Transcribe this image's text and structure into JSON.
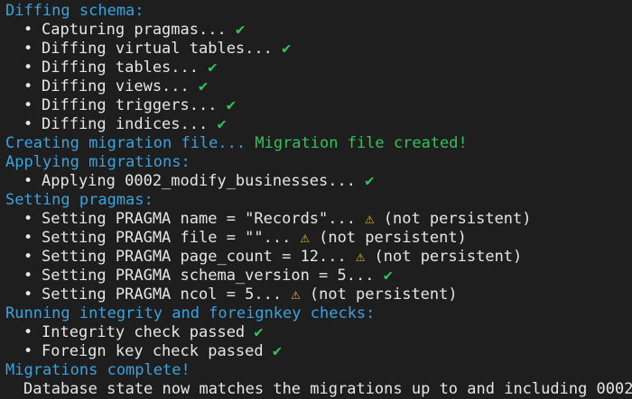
{
  "terminal": {
    "lines": [
      {
        "kind": "heading",
        "text": "Diffing schema:"
      },
      {
        "kind": "bullet",
        "text": "Capturing pragmas...",
        "status": "✔"
      },
      {
        "kind": "bullet",
        "text": "Diffing virtual tables...",
        "status": "✔"
      },
      {
        "kind": "bullet",
        "text": "Diffing tables...",
        "status": "✔"
      },
      {
        "kind": "bullet",
        "text": "Diffing views...",
        "status": "✔"
      },
      {
        "kind": "bullet",
        "text": "Diffing triggers...",
        "status": "✔"
      },
      {
        "kind": "bullet",
        "text": "Diffing indices...",
        "status": "✔"
      },
      {
        "kind": "heading-result",
        "text": "Creating migration file...",
        "result": "Migration file created!"
      },
      {
        "kind": "heading",
        "text": "Applying migrations:"
      },
      {
        "kind": "bullet",
        "text": "Applying 0002_modify_businesses...",
        "status": "✔"
      },
      {
        "kind": "heading",
        "text": "Setting pragmas:"
      },
      {
        "kind": "bullet-warn",
        "text": "Setting PRAGMA name = \"Records\"...",
        "status": "⚠",
        "note": "(not persistent)"
      },
      {
        "kind": "bullet-warn",
        "text": "Setting PRAGMA file = \"\"...",
        "status": "⚠",
        "note": "(not persistent)"
      },
      {
        "kind": "bullet-warn",
        "text": "Setting PRAGMA page_count = 12...",
        "status": "⚠",
        "note": "(not persistent)"
      },
      {
        "kind": "bullet",
        "text": "Setting PRAGMA schema_version = 5...",
        "status": "✔"
      },
      {
        "kind": "bullet-warn",
        "text": "Setting PRAGMA ncol = 5...",
        "status": "⚠",
        "note": "(not persistent)"
      },
      {
        "kind": "heading",
        "text": "Running integrity and foreignkey checks:"
      },
      {
        "kind": "bullet",
        "text": "Integrity check passed",
        "status": "✔"
      },
      {
        "kind": "bullet",
        "text": "Foreign key check passed",
        "status": "✔"
      },
      {
        "kind": "heading",
        "text": "Migrations complete!"
      },
      {
        "kind": "plain",
        "text": "Database state now matches the migrations up to and including 0002."
      }
    ],
    "bullet_glyph": "•"
  },
  "colors": {
    "background": "#1e1e1e",
    "text": "#e6e6e6",
    "heading": "#3aa2dd",
    "check": "#33c25a",
    "warning": "#f2c500"
  }
}
